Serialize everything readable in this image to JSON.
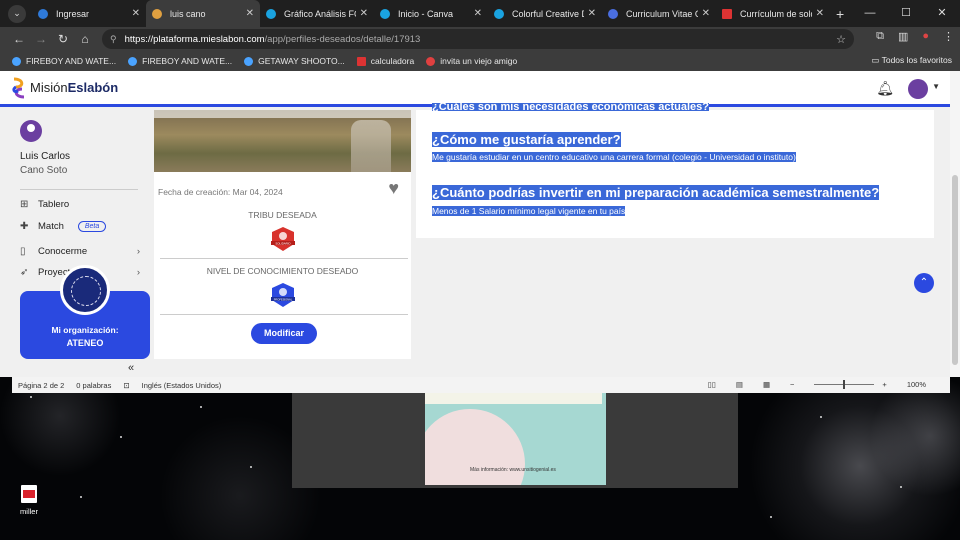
{
  "browser": {
    "tabs": [
      {
        "title": "Ingresar",
        "color": "#2f7ad9",
        "active": false
      },
      {
        "title": "luis cano",
        "color": "#e0a040",
        "active": true
      },
      {
        "title": "Gráfico Análisis FODA",
        "color": "#1aa3e0",
        "active": false
      },
      {
        "title": "Inicio - Canva",
        "color": "#1aa3e0",
        "active": false
      },
      {
        "title": "Colorful Creative Doc",
        "color": "#1aa3e0",
        "active": false
      },
      {
        "title": "Curriculum Vitae CV p",
        "color": "#4a6ee0",
        "active": false
      },
      {
        "title": "Currículum de soldad",
        "color": "#d33",
        "active": false
      }
    ],
    "new_tab": "+",
    "url_host": "https://plataforma.mieslabon.com",
    "url_path": "/app/perfiles-deseados/detalle/17913",
    "bookmarks": [
      {
        "label": "FIREBOY AND WATE..."
      },
      {
        "label": "FIREBOY AND WATE..."
      },
      {
        "label": "GETAWAY SHOOTO..."
      },
      {
        "label": "calculadora"
      },
      {
        "label": "invita un viejo amigo"
      }
    ],
    "all_bookmarks": "Todos los favoritos"
  },
  "site": {
    "logo_light": "Misión",
    "logo_bold": "Eslabón",
    "accent": "#2b49e0"
  },
  "sidebar": {
    "first_name": "Luis Carlos",
    "last_name": "Cano Soto",
    "items": [
      {
        "label": "Tablero",
        "icon": "grid-icon"
      },
      {
        "label": "Match",
        "icon": "puzzle-icon",
        "badge": "Beta"
      },
      {
        "label": "Conocerme",
        "icon": "user-icon"
      },
      {
        "label": "Proyect",
        "icon": "rocket-icon"
      }
    ],
    "org_label": "Mi organización:",
    "org_name": "ATENEO",
    "collapse": "«"
  },
  "card": {
    "created": "Fecha de creación: Mar 04, 2024",
    "tribe_title": "TRIBU DESEADA",
    "tribe_badge_text": "SOLIDARIO",
    "level_title": "NIVEL DE CONOCIMIENTO DESEADO",
    "level_badge_text": "PROFESIONAL",
    "modify": "Modificar"
  },
  "content": {
    "q_top": "¿Cuáles son mis necesidades económicas actuales?",
    "q1": "¿Cómo me gustaría aprender?",
    "a1": "Me gustaría estudiar en un centro educativo una carrera formal (colegio - Universidad o instituto)",
    "q2": "¿Cuánto podrías invertir en mi preparación académica semestralmente?",
    "a2": "Menos de 1 Salario mínimo legal vigente en tu país"
  },
  "word": {
    "page": "Página 2 de 2",
    "words": "0 palabras",
    "language": "Inglés (Estados Unidos)",
    "zoom": "100%",
    "doc_text": "Más información: www.unsitiogenial.es"
  },
  "desktop": {
    "icon_label": "miller"
  }
}
